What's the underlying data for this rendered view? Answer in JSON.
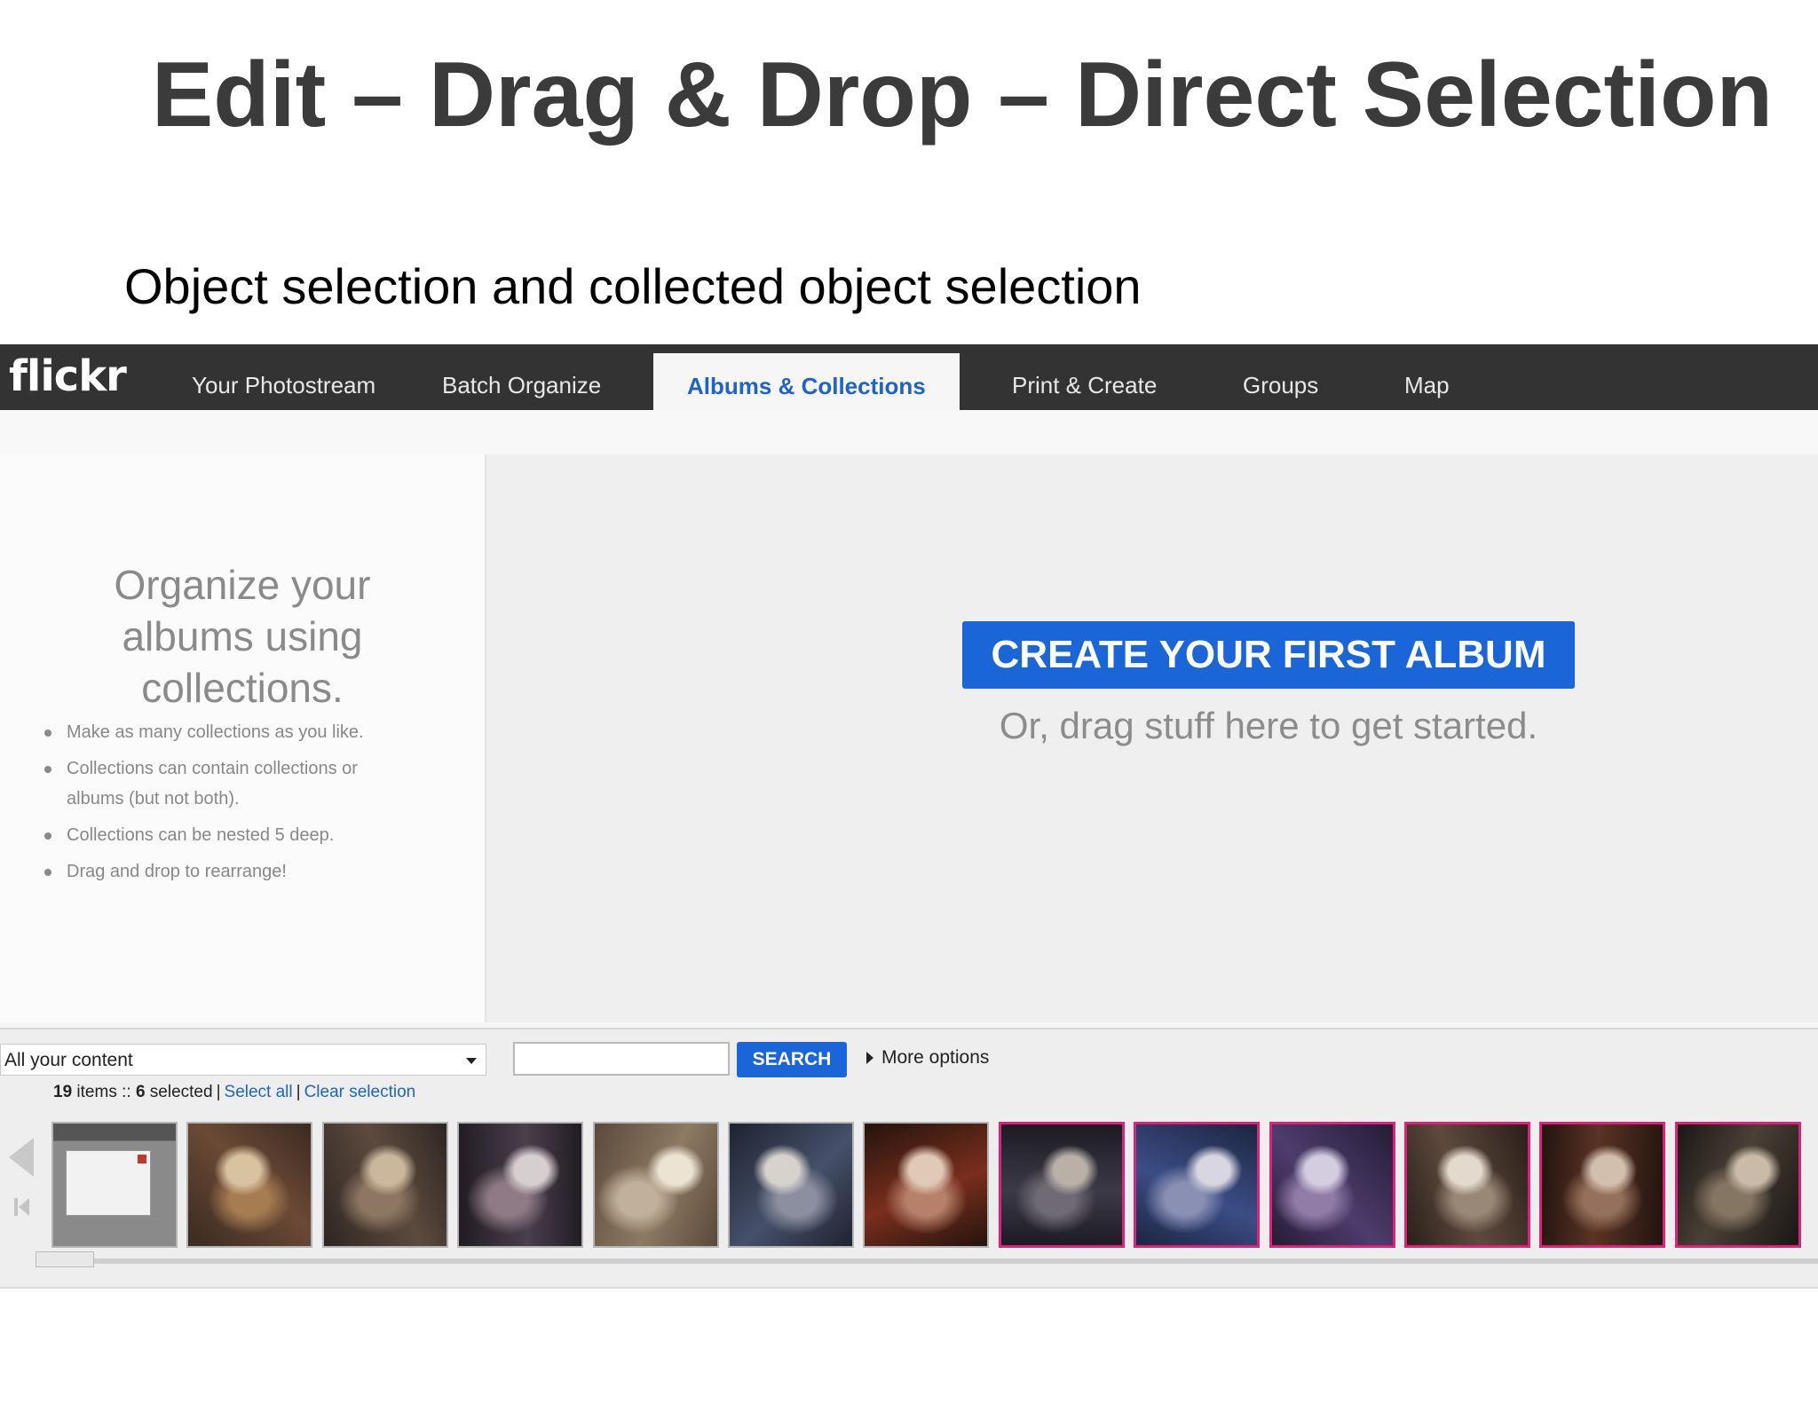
{
  "slide": {
    "title": "Edit – Drag & Drop – Direct Selection",
    "subtitle": "Object selection and collected object selection"
  },
  "navbar": {
    "logo": "flickr",
    "items": [
      {
        "label": "Your Photostream",
        "active": false
      },
      {
        "label": "Batch Organize",
        "active": false
      },
      {
        "label": "Albums & Collections",
        "active": true
      },
      {
        "label": "Print & Create",
        "active": false
      },
      {
        "label": "Groups",
        "active": false
      },
      {
        "label": "Map",
        "active": false
      }
    ]
  },
  "sidebar": {
    "heading": "Organize your albums using collections.",
    "tips": [
      "Make as many collections as you like.",
      "Collections can contain collections or albums (but not both).",
      "Collections can be nested 5 deep.",
      "Drag and drop to rearrange!"
    ]
  },
  "workspace": {
    "create_button": "CREATE YOUR FIRST ALBUM",
    "hint": "Or, drag stuff here to get started."
  },
  "organizr": {
    "content_filter": "All your content",
    "search_placeholder": "",
    "search_button": "SEARCH",
    "more_options": "More options",
    "item_count": "19",
    "items_label": "items ::",
    "selected_count": "6",
    "selected_label": "selected",
    "select_all": "Select all",
    "clear_selection": "Clear selection",
    "separator": "|",
    "thumbnails": [
      {
        "name": "screenshot",
        "selected": false
      },
      {
        "name": "photo-2",
        "selected": false
      },
      {
        "name": "photo-3",
        "selected": false
      },
      {
        "name": "photo-4",
        "selected": false
      },
      {
        "name": "photo-5",
        "selected": false
      },
      {
        "name": "photo-6",
        "selected": false
      },
      {
        "name": "photo-7",
        "selected": false
      },
      {
        "name": "photo-8",
        "selected": true
      },
      {
        "name": "photo-9",
        "selected": true
      },
      {
        "name": "photo-10",
        "selected": true
      },
      {
        "name": "photo-11",
        "selected": true
      },
      {
        "name": "photo-12",
        "selected": true
      },
      {
        "name": "photo-13",
        "selected": true
      }
    ]
  },
  "colors": {
    "navbar": "#333333",
    "accent_blue": "#1a66d8",
    "selection_pink": "#e0207a"
  }
}
